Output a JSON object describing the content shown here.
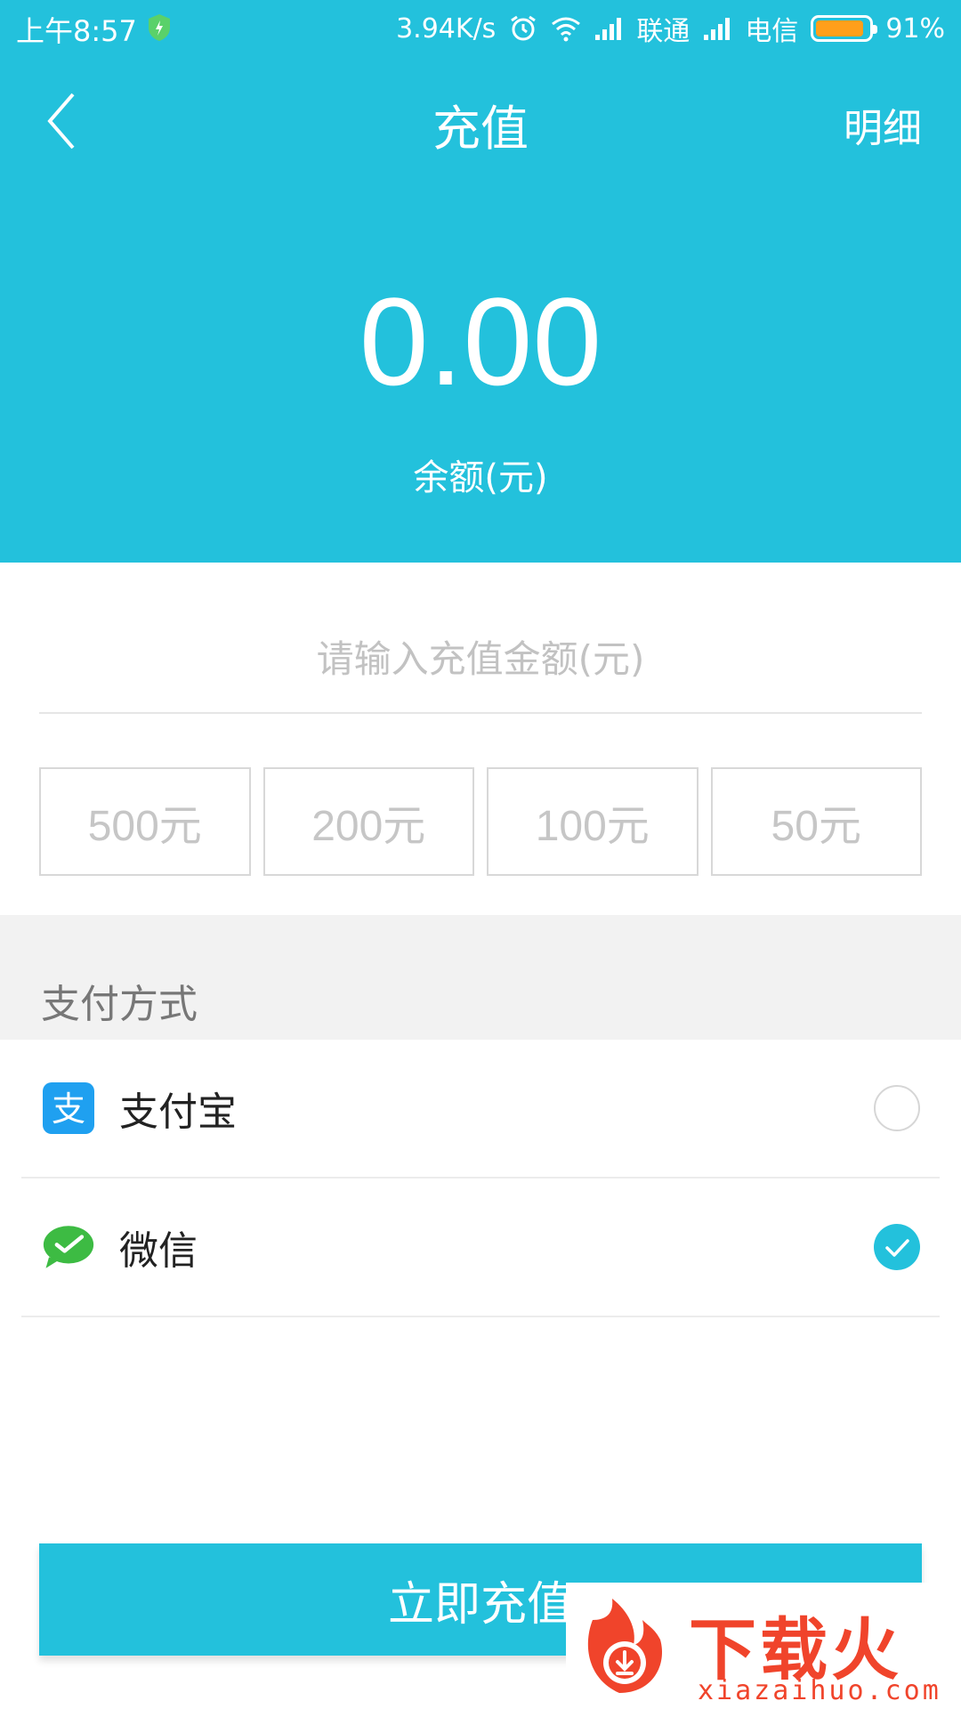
{
  "status_bar": {
    "time": "上午8:57",
    "speed": "3.94K/s",
    "carrier1": "联通",
    "carrier2": "电信",
    "battery": "91%",
    "battery_level": 0.91,
    "battery_color": "#ff9f1a",
    "icons": [
      "shield-icon",
      "alarm-icon",
      "wifi-icon",
      "signal-icon",
      "battery-icon"
    ]
  },
  "header": {
    "title": "充值",
    "detail_link": "明细",
    "back_icon": "chevron-left-icon",
    "balance_value": "0.00",
    "balance_label": "余额(元)",
    "accent_color": "#23c1dc"
  },
  "amount_input": {
    "placeholder": "请输入充值金额(元)",
    "value": ""
  },
  "presets": [
    "500元",
    "200元",
    "100元",
    "50元"
  ],
  "payment": {
    "section_title": "支付方式",
    "methods": [
      {
        "name": "支付宝",
        "icon": "alipay-icon",
        "selected": false
      },
      {
        "name": "微信",
        "icon": "wechat-icon",
        "selected": true
      }
    ]
  },
  "submit_label": "立即充值",
  "watermark": {
    "brand": "下载火",
    "url": "xiazaihuo.com"
  }
}
